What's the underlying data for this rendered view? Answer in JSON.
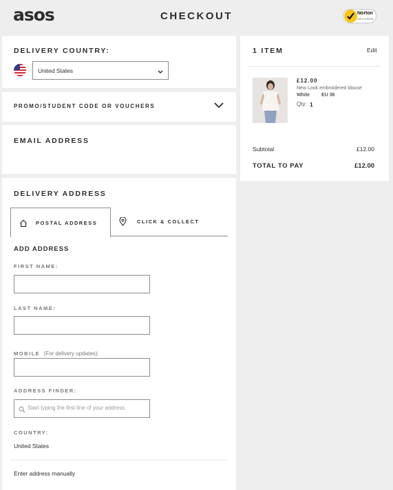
{
  "header": {
    "logo": "asos",
    "title": "CHECKOUT",
    "badge": {
      "name": "Norton",
      "sub": "SECURED"
    }
  },
  "delivery_country": {
    "label": "DELIVERY COUNTRY:",
    "selected": "United States",
    "flag_icon": "us-flag-icon"
  },
  "promo": {
    "label": "PROMO/STUDENT CODE OR VOUCHERS"
  },
  "email": {
    "label": "EMAIL ADDRESS"
  },
  "delivery_address": {
    "title": "DELIVERY ADDRESS",
    "tabs": [
      {
        "label": "POSTAL ADDRESS",
        "icon": "home-icon",
        "active": true
      },
      {
        "label": "CLICK & COLLECT",
        "icon": "location-pin-icon",
        "active": false
      }
    ],
    "add_address_title": "ADD ADDRESS",
    "fields": {
      "first_name": {
        "label": "FIRST NAME:",
        "value": ""
      },
      "last_name": {
        "label": "LAST NAME:",
        "value": ""
      },
      "mobile": {
        "label": "MOBILE",
        "note": "(For delivery updates):",
        "value": ""
      },
      "address_finder": {
        "label": "ADDRESS FINDER:",
        "placeholder": "Start typing the first line of your address."
      }
    },
    "country_label": "COUNTRY:",
    "country_value": "United States",
    "manual_link": "Enter address manually"
  },
  "summary": {
    "items_title": "1 ITEM",
    "edit_label": "Edit",
    "product": {
      "price": "£12.00",
      "name": "New Look embroidered blouse",
      "color": "White",
      "size": "EU 36",
      "qty_label": "Qty:",
      "qty": "1"
    },
    "subtotal_label": "Subtotal",
    "subtotal_value": "£12.00",
    "total_label": "TOTAL TO PAY",
    "total_value": "£12.00"
  },
  "colors": {
    "background": "#eeeeee",
    "text": "#2d2d2d",
    "badge_yellow": "#f5c518"
  }
}
